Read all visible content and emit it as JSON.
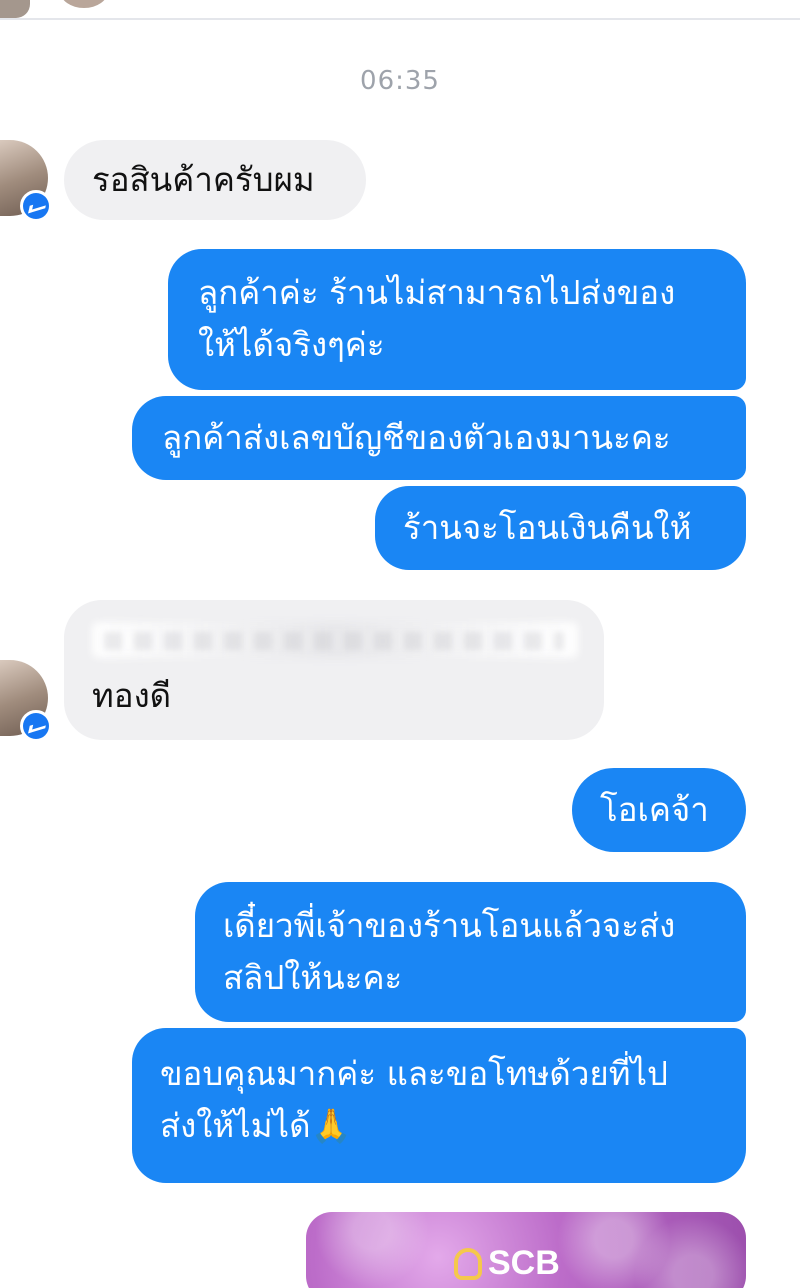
{
  "timestamp": "06:35",
  "messages": [
    {
      "side": "in",
      "text": "รอสินค้าครับผม"
    },
    {
      "side": "out",
      "lines": [
        "ลูกค้าค่ะ ร้านไม่สามารถไปส่งของ",
        "ให้ได้จริงๆค่ะ"
      ]
    },
    {
      "side": "out",
      "text": "ลูกค้าส่งเลขบัญชีของตัวเองมานะคะ"
    },
    {
      "side": "out",
      "text": "ร้านจะโอนเงินคืนให้"
    },
    {
      "side": "in",
      "lines": [
        "",
        "ทองดี"
      ]
    },
    {
      "side": "out",
      "text": "โอเคจ้า"
    },
    {
      "side": "out",
      "lines": [
        "เดี๋ยวพี่เจ้าของร้านโอนแล้วจะส่ง",
        "สลิปให้นะคะ"
      ]
    },
    {
      "side": "out",
      "lines": [
        "ขอบคุณมากค่ะ และขอโทษด้วยที่ไป",
        "ส่งให้ไม่ได้🙏"
      ]
    }
  ],
  "attachment": {
    "brand": "SCB"
  },
  "colors": {
    "outgoing": "#1a86f4",
    "incoming": "#f0f0f2",
    "timestamp": "#9ea3ab"
  },
  "icons": [
    "messenger-badge-icon",
    "scb-logo-icon"
  ]
}
